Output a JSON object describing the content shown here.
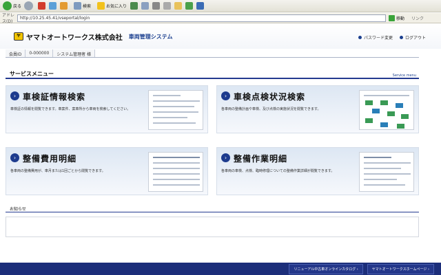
{
  "toolbar": {
    "back_label": "戻る",
    "search_label": "検索",
    "favorites_label": "お気に入り",
    "go_label": "移動",
    "links_label": "リンク"
  },
  "address": {
    "label": "アドレス(D)",
    "url": "http://10.25.45.41/vseportal/login"
  },
  "header": {
    "company": "ヤマトオートワークス株式会社",
    "system": "車両管理システム",
    "password_change": "パスワード変更",
    "logout": "ログアウト"
  },
  "userbar": {
    "member_label": "会員ID",
    "member_id": "0-000000",
    "role": "システム管理者 様"
  },
  "service": {
    "title": "サービスメニュー",
    "title_en": "Service menu"
  },
  "cards": [
    {
      "title": "車検証情報検索",
      "desc": "車検証の情報を閲覧できます。車案件、案車所から車両を検索してください。"
    },
    {
      "title": "車検点検状況検索",
      "desc": "各車両の整備計画や車検、及び点検の実施状況を閲覧できます。"
    },
    {
      "title": "整備費用明細",
      "desc": "各車両の整備費用が、車月または1回ごとから閲覧できます。"
    },
    {
      "title": "整備作業明細",
      "desc": "各車両の車検、点検、臨時修理についての整備作業詳細が閲覧できます。"
    }
  ],
  "notice": {
    "title": "お知らせ"
  },
  "footer": {
    "link1": "リニューアル中古車オンラインカタログ ›",
    "link2": "ヤマトオートワークスホームページ ›"
  },
  "colors": {
    "accent": "#1d3b8e",
    "footer": "#1c2e7a"
  }
}
